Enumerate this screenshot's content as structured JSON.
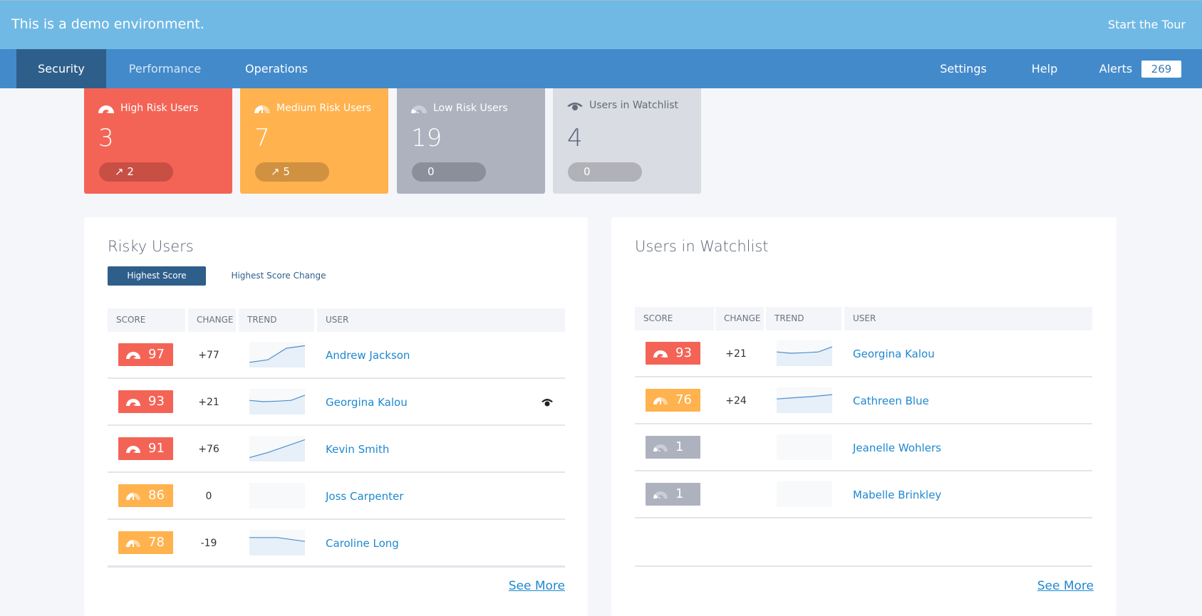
{
  "banner": {
    "text": "This is a demo environment.",
    "tour_label": "Start the Tour"
  },
  "nav": {
    "tabs": [
      {
        "label": "Security",
        "active": true
      },
      {
        "label": "Performance",
        "active": false
      },
      {
        "label": "Operations",
        "active": false
      }
    ],
    "settings_label": "Settings",
    "help_label": "Help",
    "alerts_label": "Alerts",
    "alerts_count": "269"
  },
  "summary_cards": [
    {
      "title": "High Risk Users",
      "count": "3",
      "change": "2",
      "trend_arrow": "↗",
      "icon": "gauge-high-icon",
      "color": "#f46456"
    },
    {
      "title": "Medium Risk Users",
      "count": "7",
      "change": "5",
      "trend_arrow": "↗",
      "icon": "gauge-medium-icon",
      "color": "#ffb24d"
    },
    {
      "title": "Low Risk Users",
      "count": "19",
      "change": "0",
      "trend_arrow": "",
      "icon": "gauge-low-icon",
      "color": "#adb2be"
    },
    {
      "title": "Users in Watchlist",
      "count": "4",
      "change": "0",
      "trend_arrow": "",
      "icon": "eye-icon",
      "color": "#d9dce2"
    }
  ],
  "risky_users": {
    "title": "Risky Users",
    "tabs": [
      {
        "label": "Highest Score",
        "active": true
      },
      {
        "label": "Highest Score Change",
        "active": false
      }
    ],
    "columns": [
      "SCORE",
      "CHANGE",
      "TREND",
      "USER"
    ],
    "rows": [
      {
        "score": "97",
        "level": "high",
        "change": "+77",
        "trend": [
          0.2,
          0.3,
          0.75,
          0.85
        ],
        "user": "Andrew Jackson",
        "watchlisted": false
      },
      {
        "score": "93",
        "level": "high",
        "change": "+21",
        "trend": [
          0.55,
          0.5,
          0.52,
          0.55,
          0.75
        ],
        "user": "Georgina Kalou",
        "watchlisted": true
      },
      {
        "score": "91",
        "level": "high",
        "change": "+76",
        "trend": [
          0.15,
          0.35,
          0.6,
          0.85
        ],
        "user": "Kevin Smith",
        "watchlisted": false
      },
      {
        "score": "86",
        "level": "medium",
        "change": "0",
        "trend": [],
        "user": "Joss Carpenter",
        "watchlisted": false
      },
      {
        "score": "78",
        "level": "medium",
        "change": "-19",
        "trend": [
          0.7,
          0.7,
          0.55
        ],
        "user": "Caroline Long",
        "watchlisted": false
      }
    ],
    "see_more_label": "See More"
  },
  "watchlist": {
    "title": "Users in Watchlist",
    "columns": [
      "SCORE",
      "CHANGE",
      "TREND",
      "USER"
    ],
    "rows": [
      {
        "score": "93",
        "level": "high",
        "change": "+21",
        "trend": [
          0.55,
          0.5,
          0.52,
          0.55,
          0.75
        ],
        "user": "Georgina Kalou"
      },
      {
        "score": "76",
        "level": "medium",
        "change": "+24",
        "trend": [
          0.55,
          0.6,
          0.65,
          0.72
        ],
        "user": "Cathreen Blue"
      },
      {
        "score": "1",
        "level": "low",
        "change": "",
        "trend": [],
        "user": "Jeanelle Wohlers"
      },
      {
        "score": "1",
        "level": "low",
        "change": "",
        "trend": [],
        "user": "Mabelle Brinkley"
      }
    ],
    "see_more_label": "See More"
  }
}
